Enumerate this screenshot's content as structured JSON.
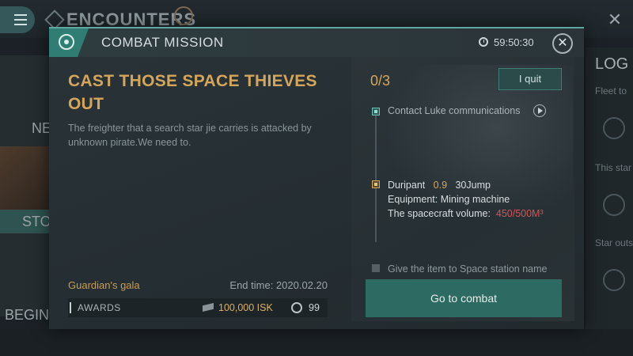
{
  "background": {
    "title": "ENCOUNTERS",
    "left_text_1": "NE",
    "left_text_2": "STO",
    "left_text_3": "BEGINN",
    "right_title": "LOG",
    "right_items": [
      "Fleet to",
      "This star",
      "Star outs"
    ]
  },
  "modal": {
    "header_title": "COMBAT MISSION",
    "timer": "59:50:30",
    "mission_title": "CAST THOSE SPACE THIEVES OUT",
    "description": "The freighter that a search star jie carries is attacked by unknown pirate.We need to.",
    "guild_name": "Guardian's gala",
    "end_time": "End time: 2020.02.20",
    "awards_label": "AWARDS",
    "isk_amount": "100,000 ISK",
    "coin_amount": "99",
    "progress": "0/3",
    "quit_label": "I quit",
    "steps": [
      {
        "label": "Contact Luke communications",
        "state": "done"
      },
      {
        "name": "Duripant",
        "rating": "0.9",
        "jump": "30Jump",
        "equipment": "Equipment: Mining machine",
        "volume_label": "The spacecraft volume:",
        "volume_value": "450/500M³",
        "state": "active"
      },
      {
        "label": "Give the item to Space station name",
        "state": "todo"
      }
    ],
    "combat_label": "Go to combat"
  },
  "colors": {
    "accent_teal": "#2d6a62",
    "gold": "#d4a65c",
    "warning_red": "#d0565a"
  },
  "icons": [
    "menu-icon",
    "mission-icon",
    "clock-icon",
    "close-icon",
    "play-icon",
    "isk-icon",
    "coin-icon"
  ]
}
